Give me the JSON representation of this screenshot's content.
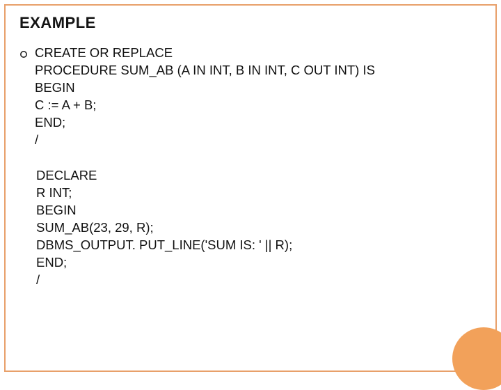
{
  "title": "EXAMPLE",
  "block1": "CREATE OR REPLACE\nPROCEDURE SUM_AB (A IN INT, B IN INT, C OUT INT) IS\nBEGIN\nC := A + B;\nEND;\n/",
  "block2": "DECLARE\nR INT;\nBEGIN\nSUM_AB(23, 29, R);\nDBMS_OUTPUT. PUT_LINE('SUM IS: ' || R);\nEND;\n/"
}
